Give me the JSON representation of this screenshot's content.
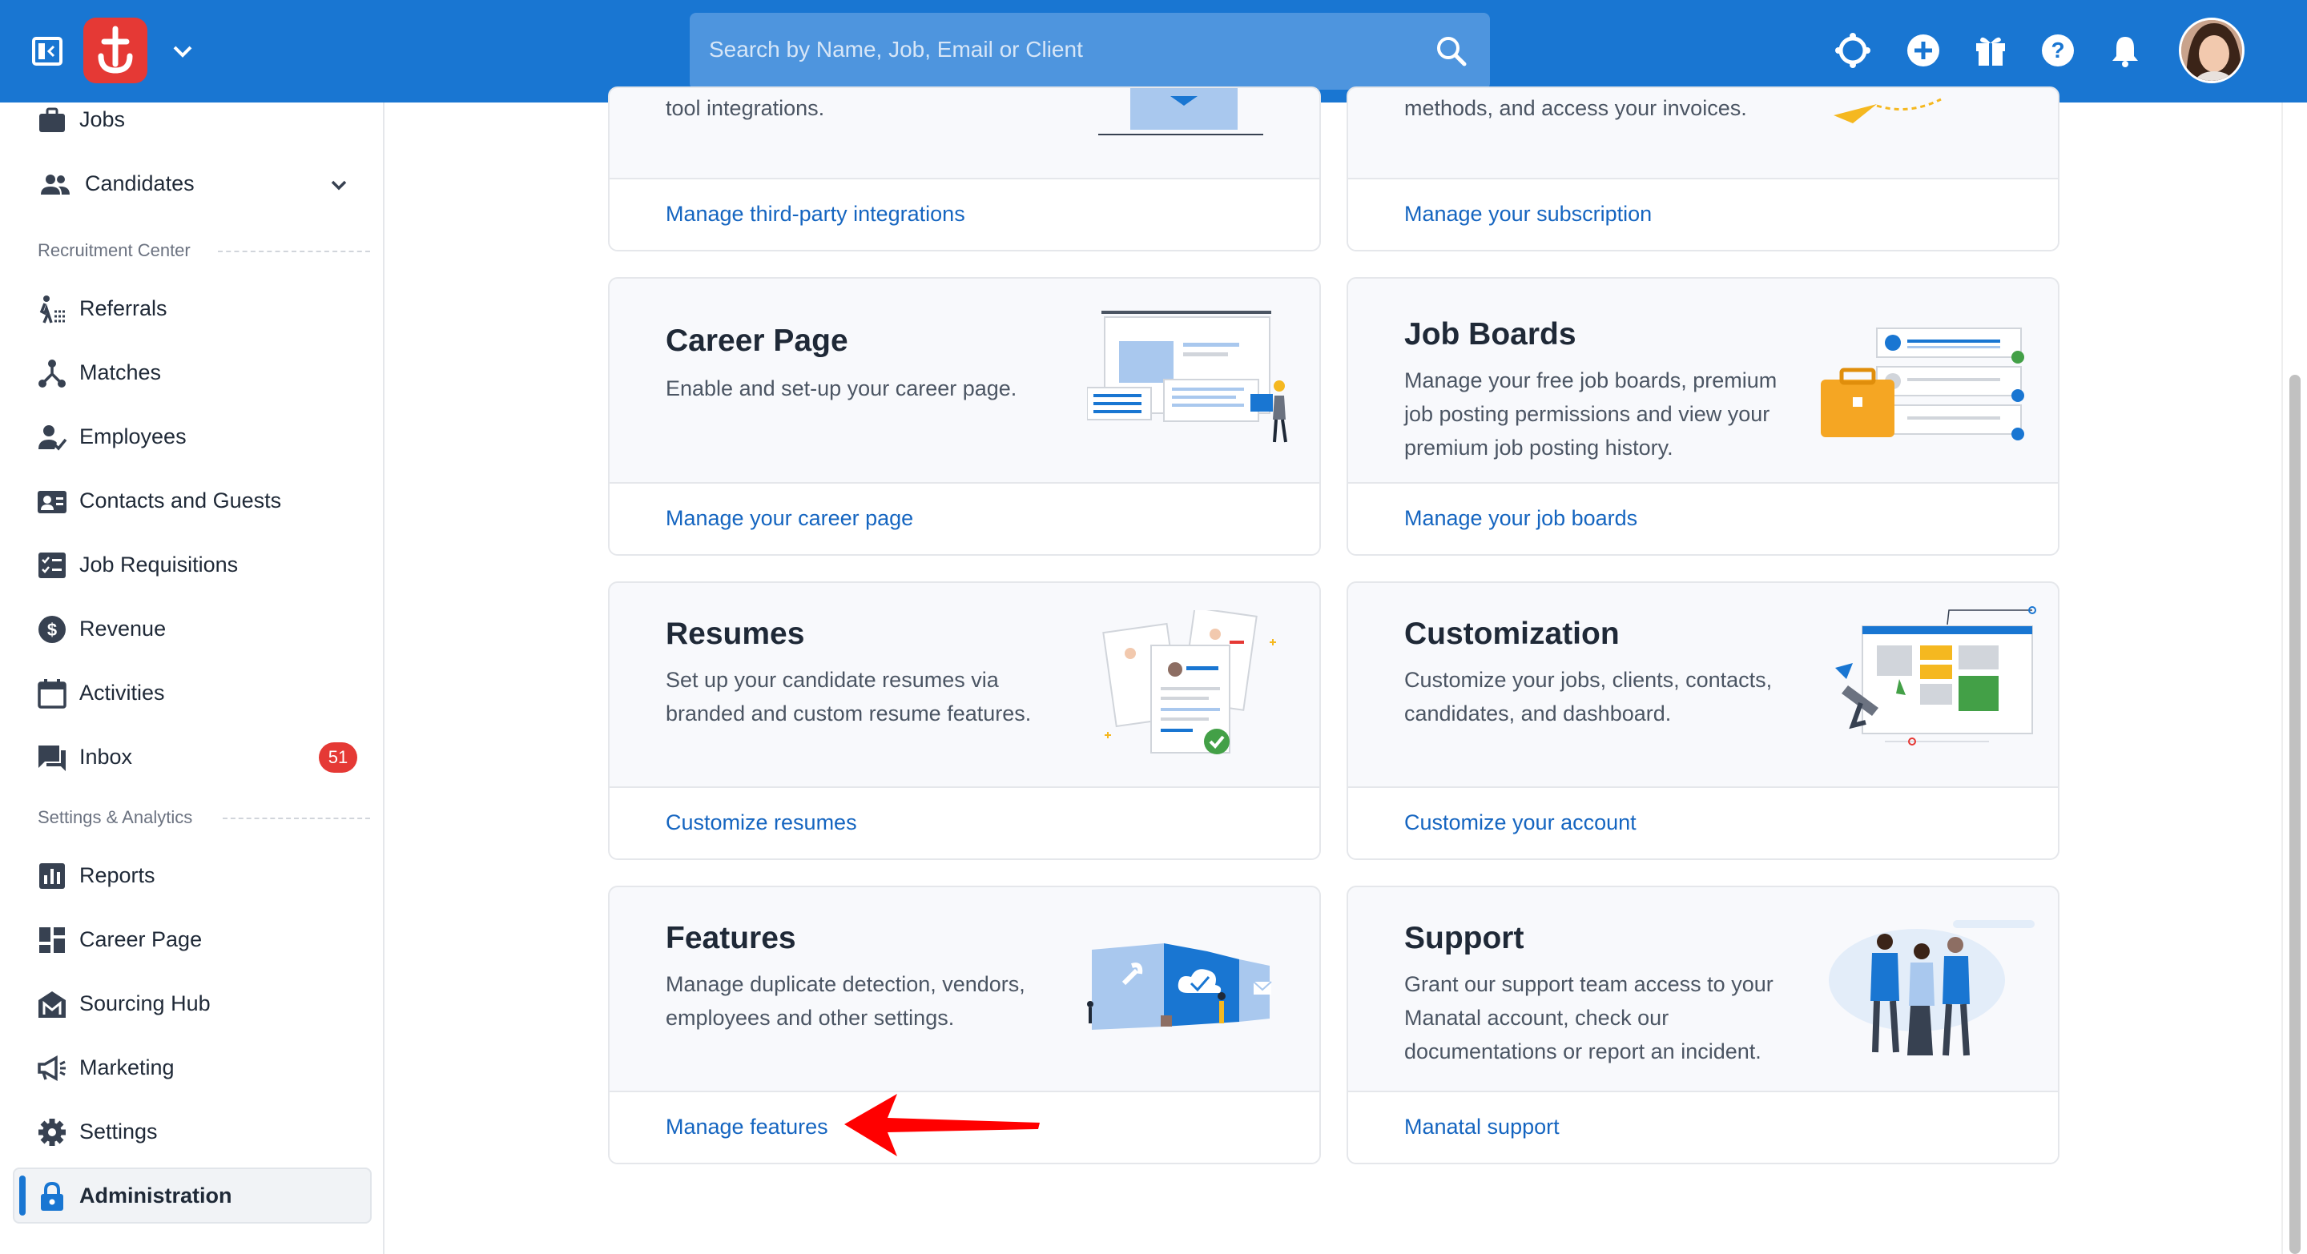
{
  "topbar": {
    "search_placeholder": "Search by Name, Job, Email or Client",
    "icons": [
      "sidebar-toggle-icon",
      "logo",
      "chevron-down-icon",
      "search-icon",
      "extensions-icon",
      "add-circle-icon",
      "gift-icon",
      "help-icon",
      "notification-bell-icon",
      "avatar"
    ]
  },
  "sidebar": {
    "items_top": [
      {
        "label": "Jobs",
        "icon": "briefcase-icon"
      },
      {
        "label": "Candidates",
        "icon": "people-icon"
      }
    ],
    "section_recruitment": "Recruitment Center",
    "items_recruitment": [
      {
        "label": "Referrals",
        "icon": "referrals-icon"
      },
      {
        "label": "Matches",
        "icon": "matches-icon"
      },
      {
        "label": "Employees",
        "icon": "employees-icon"
      },
      {
        "label": "Contacts and Guests",
        "icon": "contacts-icon"
      },
      {
        "label": "Job Requisitions",
        "icon": "requisitions-icon"
      },
      {
        "label": "Revenue",
        "icon": "dollar-icon"
      },
      {
        "label": "Activities",
        "icon": "calendar-icon"
      },
      {
        "label": "Inbox",
        "icon": "inbox-icon",
        "badge": "51"
      }
    ],
    "section_settings": "Settings & Analytics",
    "items_settings": [
      {
        "label": "Reports",
        "icon": "bar-chart-icon"
      },
      {
        "label": "Career Page",
        "icon": "dashboard-icon"
      },
      {
        "label": "Sourcing Hub",
        "icon": "sourcing-hub-icon"
      },
      {
        "label": "Marketing",
        "icon": "megaphone-icon"
      },
      {
        "label": "Settings",
        "icon": "gear-icon"
      },
      {
        "label": "Administration",
        "icon": "lock-icon",
        "active": true
      }
    ]
  },
  "cards": {
    "integrations": {
      "desc_partial": "tool integrations.",
      "link": "Manage third-party integrations"
    },
    "subscription": {
      "desc_partial": "methods, and access your invoices.",
      "link": "Manage your subscription"
    },
    "career_page": {
      "title": "Career Page",
      "desc": "Enable and set-up your career page.",
      "link": "Manage your career page"
    },
    "job_boards": {
      "title": "Job Boards",
      "desc": "Manage your free job boards, premium job posting permissions and view your premium job posting history.",
      "link": "Manage your job boards"
    },
    "resumes": {
      "title": "Resumes",
      "desc": "Set up your candidate resumes via branded and custom resume features.",
      "link": "Customize resumes"
    },
    "customization": {
      "title": "Customization",
      "desc": "Customize your jobs, clients, contacts, candidates, and dashboard.",
      "link": "Customize your account"
    },
    "features": {
      "title": "Features",
      "desc": "Manage duplicate detection, vendors, employees and other settings.",
      "link": "Manage features"
    },
    "support": {
      "title": "Support",
      "desc": "Grant our support team access to your Manatal account, check our documentations or report an incident.",
      "link": "Manatal support"
    }
  },
  "colors": {
    "brand_blue": "#1976d2",
    "logo_red": "#e53935",
    "link_blue": "#1565c0",
    "arrow_red": "#ff0000"
  }
}
